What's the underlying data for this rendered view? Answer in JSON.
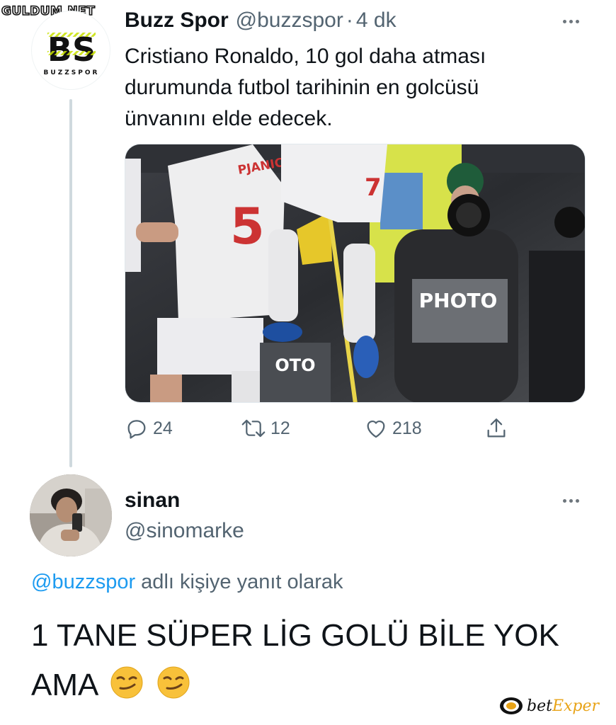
{
  "watermark": "GULDUM.NET",
  "tweet": {
    "avatar_monogram": "BS",
    "avatar_caption": "BUZZSPOR",
    "author_name": "Buzz Spor",
    "author_handle": "@buzzspor",
    "separator": "·",
    "time": "4 dk",
    "text_lines": [
      "Cristiano Ronaldo, 10 gol daha atması",
      "durumunda futbol tarihinin en golcüsü",
      "ünvanını elde edecek."
    ],
    "media": {
      "jersey_name": "PJANIC",
      "jersey_number_left": "5",
      "jersey_number_right": "7",
      "vest_text": "PHOTO",
      "vest_text_2": "OTO"
    },
    "counts": {
      "replies": "24",
      "retweets": "12",
      "likes": "218"
    },
    "icons": [
      "reply-icon",
      "retweet-icon",
      "like-icon",
      "share-icon",
      "more-icon"
    ]
  },
  "reply": {
    "author_name": "sinan",
    "author_handle": "@sinomarke",
    "replying_mention": "@buzzspor",
    "replying_suffix": " adlı kişiye yanıt olarak",
    "text_line1": "1 TANE SÜPER LİG GOLÜ BİLE YOK",
    "text_line2": "AMA",
    "emojis": [
      "smirking-face",
      "smirking-face"
    ]
  },
  "brand": {
    "prefix": "bet",
    "accent": "Exper"
  },
  "colors": {
    "link": "#1d9bf0",
    "secondary_text": "#536471",
    "primary_text": "#0f1419",
    "thread_line": "#cfd9de"
  }
}
